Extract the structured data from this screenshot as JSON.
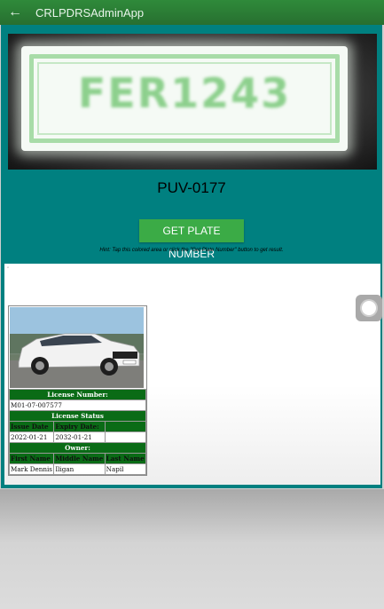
{
  "appbar": {
    "back_icon": "arrow-left-icon",
    "title": "CRLPDRSAdminApp"
  },
  "camera": {
    "plate_text": "FER1243"
  },
  "recognized_plate": "PUV-0177",
  "get_button_label": "GET PLATE NUMBER",
  "hint_text": "Hint: Tap this colored area or click the \"Get Plate Number\" button to get result.",
  "webview": {
    "marker": "◦",
    "record": {
      "license_number_label": "License Number:",
      "license_number": "M01-07-007577",
      "license_status_label": "License Status",
      "issue_date_label": "Issue Date",
      "expiry_date_label": "Expiry Date:",
      "issue_date": "2022-01-21",
      "expiry_date": "2032-01-21",
      "owner_label": "Owner:",
      "first_name_label": "First Name",
      "middle_name_label": "Middle Name",
      "last_name_label": "Last Name",
      "first_name": "Mark Dennis",
      "middle_name": "Iligan",
      "last_name": "Napil"
    }
  },
  "colors": {
    "appbar": "#2f8a3a",
    "content_bg": "#008080",
    "button": "#3bab46",
    "table_header": "#0a6b16"
  }
}
